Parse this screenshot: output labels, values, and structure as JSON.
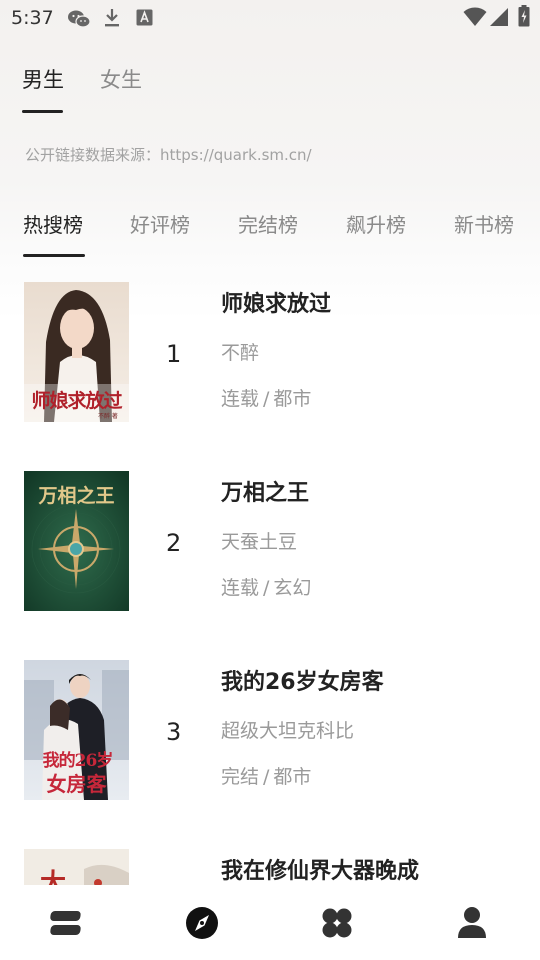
{
  "status_bar": {
    "time": "5:37"
  },
  "gender_tabs": [
    {
      "label": "男生",
      "active": true
    },
    {
      "label": "女生",
      "active": false
    }
  ],
  "source_text": "公开链接数据来源：https://quark.sm.cn/",
  "rank_tabs": [
    {
      "label": "热搜榜",
      "active": true
    },
    {
      "label": "好评榜",
      "active": false
    },
    {
      "label": "完结榜",
      "active": false
    },
    {
      "label": "飙升榜",
      "active": false
    },
    {
      "label": "新书榜",
      "active": false
    }
  ],
  "books": [
    {
      "rank": "1",
      "title": "师娘求放过",
      "author": "不醉",
      "status": "连载",
      "sep": "/",
      "genre": "都市",
      "cover_text": "师娘求放过",
      "cover_author": "不醉 著"
    },
    {
      "rank": "2",
      "title": "万相之王",
      "author": "天蚕土豆",
      "status": "连载",
      "sep": "/",
      "genre": "玄幻",
      "cover_text": "万相之王"
    },
    {
      "rank": "3",
      "title": "我的26岁女房客",
      "author": "超级大坦克科比",
      "status": "完结",
      "sep": "/",
      "genre": "都市",
      "cover_text_1": "我的26岁",
      "cover_text_2": "女房客"
    },
    {
      "rank": "4",
      "title": "我在修仙界大器晚成",
      "cover_text": "大"
    }
  ],
  "bottom_nav": [
    {
      "name": "bookshelf",
      "active": false
    },
    {
      "name": "discover",
      "active": true
    },
    {
      "name": "categories",
      "active": false
    },
    {
      "name": "profile",
      "active": false
    }
  ],
  "colors": {
    "text": "#222222",
    "muted": "#9a9a9a",
    "accent": "#222222"
  }
}
